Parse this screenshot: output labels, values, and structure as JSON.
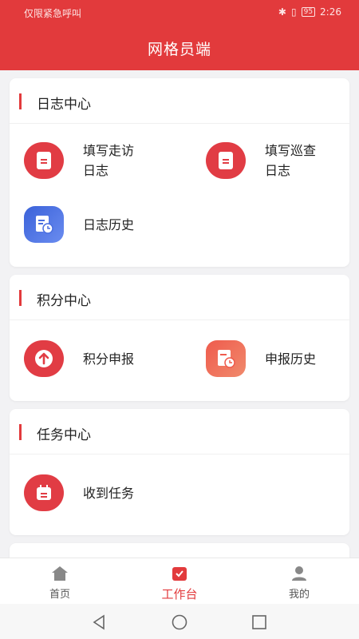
{
  "status_bar": {
    "left_text": "仅限紧急呼叫",
    "time": "2:26",
    "battery": "95"
  },
  "header": {
    "title": "网格员端"
  },
  "sections": [
    {
      "title": "日志中心",
      "items": [
        {
          "label_line1": "填写走访",
          "label_line2": "日志",
          "icon": "document-icon"
        },
        {
          "label_line1": "填写巡查",
          "label_line2": "日志",
          "icon": "document-icon"
        },
        {
          "label": "日志历史",
          "icon": "history-clock-icon"
        }
      ]
    },
    {
      "title": "积分中心",
      "items": [
        {
          "label": "积分申报",
          "icon": "upload-arrow-icon"
        },
        {
          "label": "申报历史",
          "icon": "history-clock-icon"
        }
      ]
    },
    {
      "title": "任务中心",
      "items": [
        {
          "label": "收到任务",
          "icon": "calendar-task-icon"
        }
      ]
    }
  ],
  "bottom_nav": [
    {
      "label": "首页",
      "icon": "home-icon"
    },
    {
      "label": "工作台",
      "icon": "workbench-icon",
      "active": true
    },
    {
      "label": "我的",
      "icon": "user-icon"
    }
  ],
  "colors": {
    "primary": "#e23a3c",
    "blue_icon": "#3b62d9",
    "orange_icon": "#ef5b4d"
  }
}
